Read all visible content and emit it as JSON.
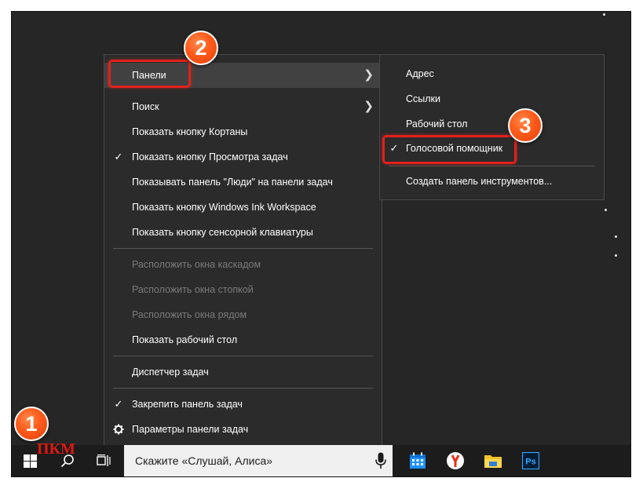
{
  "context_menu": {
    "items": [
      {
        "label": "Панели",
        "checked": false,
        "submenu": true,
        "disabled": false
      },
      {
        "label": "Поиск",
        "checked": false,
        "submenu": true,
        "disabled": false
      },
      {
        "label": "Показать кнопку Кортаны",
        "checked": false,
        "disabled": false
      },
      {
        "label": "Показать кнопку Просмотра задач",
        "checked": true,
        "disabled": false
      },
      {
        "label": "Показывать панель \"Люди\" на панели задач",
        "checked": false,
        "disabled": false
      },
      {
        "label": "Показать кнопку Windows Ink Workspace",
        "checked": false,
        "disabled": false
      },
      {
        "label": "Показать кнопку сенсорной клавиатуры",
        "checked": false,
        "disabled": false
      },
      {
        "label": "Расположить окна каскадом",
        "checked": false,
        "disabled": true
      },
      {
        "label": "Расположить окна стопкой",
        "checked": false,
        "disabled": true
      },
      {
        "label": "Расположить окна рядом",
        "checked": false,
        "disabled": true
      },
      {
        "label": "Показать рабочий стол",
        "checked": false,
        "disabled": false
      },
      {
        "label": "Диспетчер задач",
        "checked": false,
        "disabled": false
      },
      {
        "label": "Закрепить панель задач",
        "checked": true,
        "disabled": false
      },
      {
        "label": "Параметры панели задач",
        "checked": false,
        "disabled": false,
        "icon": "gear-icon"
      }
    ],
    "check_glyph": "✓",
    "arrow_glyph": "❯"
  },
  "submenu": {
    "items": [
      {
        "label": "Адрес",
        "checked": false
      },
      {
        "label": "Ссылки",
        "checked": false
      },
      {
        "label": "Рабочий стол",
        "checked": false
      },
      {
        "label": "Голосовой помощник",
        "checked": true
      },
      {
        "label": "Создать панель инструментов...",
        "checked": false
      }
    ]
  },
  "annotations": {
    "step1": "1",
    "step2": "2",
    "step3": "3",
    "pkm_label": "ПКМ",
    "highlight_color": "#e0211d",
    "badge_color": "#ff5a1a"
  },
  "taskbar": {
    "start_icon": "windows-logo-icon",
    "search_icon": "search-icon",
    "task_view_icon": "task-view-icon",
    "search_placeholder": "Скажите «Слушай, Алиса»",
    "mic_icon": "microphone-icon",
    "apps": [
      {
        "name": "calendar-icon",
        "color": "#1e90ff"
      },
      {
        "name": "yandex-browser-icon",
        "color": "#e8311c"
      },
      {
        "name": "file-explorer-icon",
        "color": "#f2c12e"
      },
      {
        "name": "photoshop-icon",
        "color": "#31a8ff",
        "text": "Ps"
      }
    ]
  }
}
